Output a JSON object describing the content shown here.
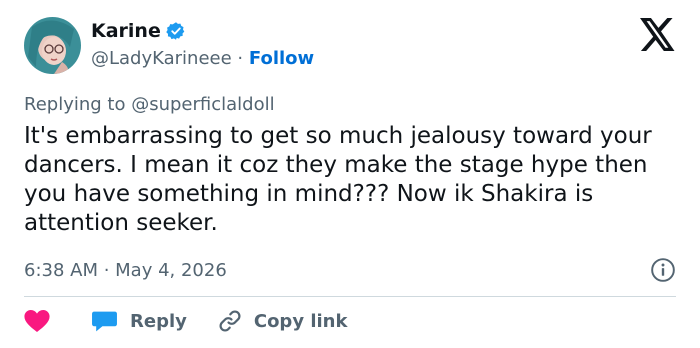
{
  "author": {
    "name": "Karine",
    "handle": "@LadyKarineee",
    "separator": "·",
    "follow_label": "Follow"
  },
  "reply": {
    "prefix": "Replying to",
    "target": "@superficlaldoll"
  },
  "tweet": {
    "text": "It's embarrassing to get so much jealousy toward your dancers. I mean it coz they make the stage hype then you have something in mind??? Now ik Shakira is attention seeker.",
    "timestamp": "6:38 AM · May 4, 2026"
  },
  "actions": {
    "reply_label": "Reply",
    "copy_link_label": "Copy link"
  },
  "colors": {
    "accent": "#006fd6",
    "heart": "#f91880",
    "verified": "#1d9bf0",
    "secondary_text": "#536471"
  },
  "icons": [
    "verified-badge-icon",
    "x-logo-icon",
    "info-icon",
    "heart-icon",
    "reply-bubble-icon",
    "link-icon"
  ]
}
